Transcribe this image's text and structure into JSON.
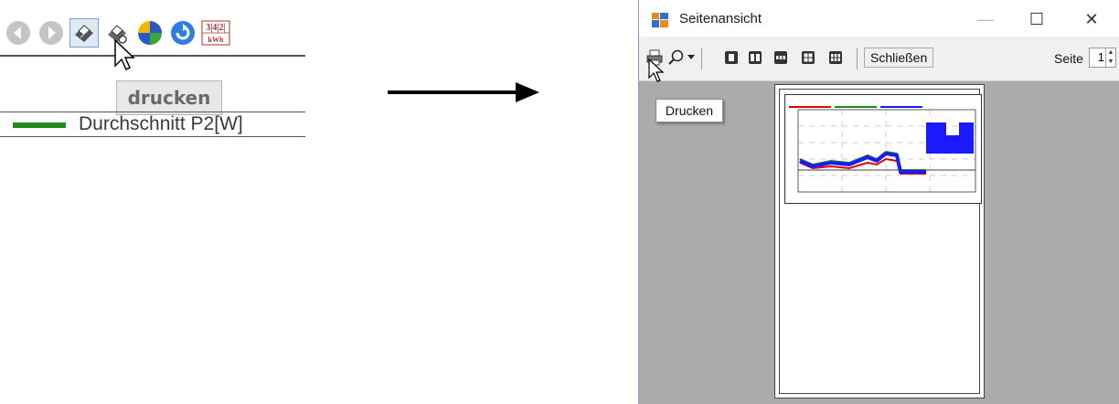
{
  "left": {
    "toolbar_icons": [
      "back-icon",
      "forward-icon",
      "print-icon",
      "print-setup-icon",
      "pie-chart-icon",
      "refresh-icon",
      "energy-counter-icon"
    ],
    "energy_counter_digits": "3|4|2|",
    "energy_counter_unit": "kWh",
    "tooltip": "drucken",
    "legend_label": "Durchschnitt P2[W]",
    "legend_color": "#1f8a1f"
  },
  "preview": {
    "window_title": "Seitenansicht",
    "minimize_glyph": "—",
    "maximize_glyph": "☐",
    "close_glyph": "✕",
    "close_button_label": "Schließen",
    "page_label": "Seite",
    "page_value": "1",
    "tooltip": "Drucken",
    "toolbar_icons": [
      "print-icon",
      "zoom-icon",
      "zoom-dropdown-icon",
      "one-page-icon",
      "two-pages-icon",
      "three-pages-icon",
      "four-pages-icon",
      "six-pages-icon"
    ]
  },
  "colors": {
    "series_red": "#e00000",
    "series_green": "#1f8a1f",
    "series_blue": "#1a1aff",
    "window_border": "#7aa0c8",
    "preview_background": "#ababab"
  }
}
